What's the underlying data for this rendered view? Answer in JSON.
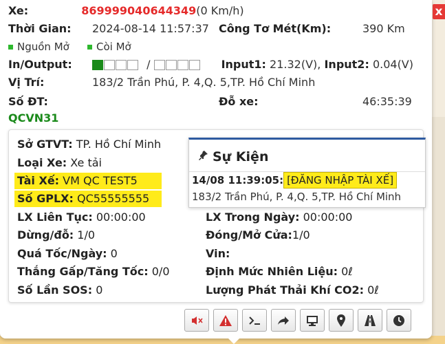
{
  "header": {
    "xe_label": "Xe:",
    "xe_id": "869999040644349",
    "xe_speed": "(0 Km/h)",
    "thoi_gian_label": "Thời Gian:",
    "thoi_gian_value": "2024-08-14 11:57:37",
    "odo_label": "Công Tơ Mét(Km):",
    "odo_value": "390 Km",
    "nguon_label": "Nguồn Mở",
    "coi_label": "Còi Mở",
    "io_label": "In/Output:",
    "io_separator": "/",
    "input1_label": "Input1:",
    "input1_value": "21.32(V),",
    "input2_label": "Input2:",
    "input2_value": "0.04(V)",
    "vitri_label": "Vị Trí:",
    "vitri_value": "183/2 Trần Phú, P. 4,Q. 5,TP. Hồ Chí Minh",
    "sodt_label": "Số ĐT:",
    "doxe_label": "Đỗ xe:",
    "doxe_value": "46:35:39",
    "qcvn": "QCVN31"
  },
  "status_colors": {
    "on": "#2eb82e",
    "id": "#e52a2a"
  },
  "io": {
    "inputs_on": 1,
    "inputs_total": 4,
    "outputs_on": 0,
    "outputs_total": 4
  },
  "details": {
    "so_gtvt_label": "Sở GTVT:",
    "so_gtvt_value": "TP. Hồ Chí Minh",
    "loai_xe_label": "Loại Xe:",
    "loai_xe_value": "Xe tải",
    "tai_xe_label": "Tài Xế:",
    "tai_xe_value": "VM QC TEST5",
    "gplx_label": "Số GPLX:",
    "gplx_value": "QC55555555",
    "lx_lien_tuc_label": "LX Liên Tục:",
    "lx_lien_tuc_value": "00:00:00",
    "lx_trong_ngay_label": "LX Trong Ngày:",
    "lx_trong_ngay_value": "00:00:00",
    "dung_do_label": "Dừng/đỗ:",
    "dung_do_value": "1/0",
    "dong_mo_label": "Đóng/Mở Cửa:",
    "dong_mo_value": "1/0",
    "qua_toc_label": "Quá Tốc/Ngày:",
    "qua_toc_value": "0",
    "vin_label": "Vin:",
    "thang_gap_label": "Thắng Gấp/Tăng Tốc:",
    "thang_gap_value": "0/0",
    "dinh_muc_label": "Định Mức Nhiên Liệu:",
    "dinh_muc_value": "0ℓ",
    "sos_label": "Số Lần SOS:",
    "sos_value": "0",
    "co2_label": "Lượng Phát Thải Khí CO2:",
    "co2_value": "0ℓ"
  },
  "event": {
    "title": "Sự Kiện",
    "time": "14/08 11:39:05:",
    "text": "[ĐĂNG NHẬP TÀI XẾ]",
    "address": "183/2 Trần Phú, P. 4,Q. 5,TP. Hồ Chí Minh"
  },
  "toolbar": {
    "buttons": [
      "mute-icon",
      "warning-icon",
      "terminal-icon",
      "share-icon",
      "monitor-icon",
      "location-pin-icon",
      "road-icon",
      "clock-icon"
    ]
  },
  "close": "x"
}
